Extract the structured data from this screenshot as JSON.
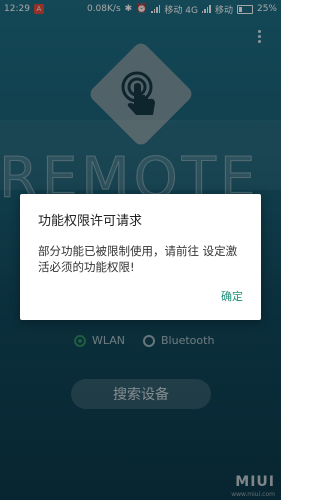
{
  "status_bar": {
    "time": "12:29",
    "net_speed": "0.08K/s",
    "carrier1": "移动 4G",
    "carrier2": "移动",
    "battery": "25%",
    "battery_level": 0.25
  },
  "background": {
    "watermark_text": "REMOTE"
  },
  "connection": {
    "options": [
      {
        "label": "WLAN",
        "selected": true
      },
      {
        "label": "Bluetooth",
        "selected": false
      }
    ]
  },
  "search_button": "搜索设备",
  "brand": {
    "logo": "MIUI",
    "sub": "www.miui.com"
  },
  "dialog": {
    "title": "功能权限许可请求",
    "message": "部分功能已被限制使用，请前往 设定激活必须的功能权限!",
    "confirm": "确定"
  },
  "icons": [
    "app-badge-icon",
    "bluetooth-icon",
    "alarm-icon",
    "signal-icon",
    "battery-icon",
    "menu-dots-icon",
    "touch-hand-icon"
  ],
  "colors": {
    "accent": "#1e8e7a",
    "radio_selected": "#2e8f63"
  }
}
